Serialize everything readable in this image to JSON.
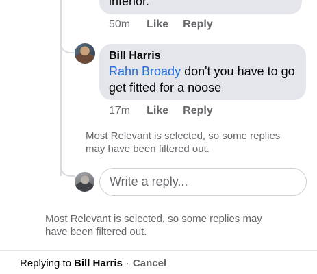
{
  "previous_comment": {
    "text_tail": "inferior.",
    "time": "50m",
    "like_label": "Like",
    "reply_label": "Reply"
  },
  "reply_comment": {
    "author": "Bill Harris",
    "mention": "Rahn Broady",
    "text": " don't you have to go get fitted for a noose",
    "time": "17m",
    "like_label": "Like",
    "reply_label": "Reply"
  },
  "nested_filter_note": "Most Relevant is selected, so some replies may have been filtered out.",
  "reply_input": {
    "placeholder": "Write a reply..."
  },
  "outer_filter_note": "Most Relevant is selected, so some replies may have been filtered out.",
  "replying_bar": {
    "prefix": "Replying to",
    "name": "Bill Harris",
    "separator": "·",
    "cancel_label": "Cancel"
  }
}
